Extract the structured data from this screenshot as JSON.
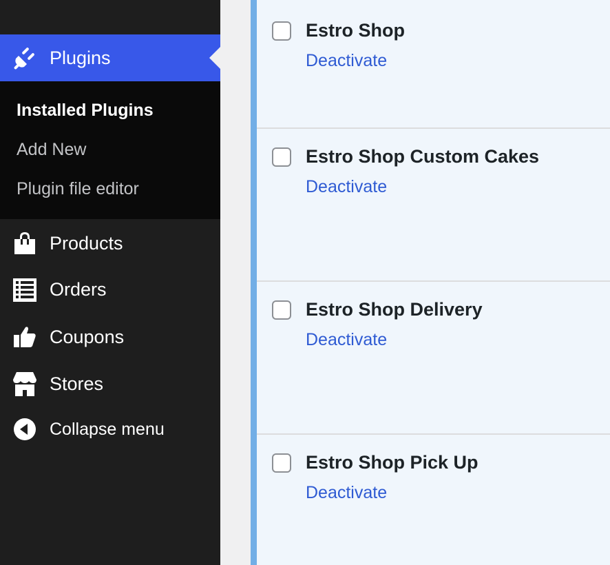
{
  "sidebar": {
    "plugins_label": "Plugins",
    "submenu": {
      "installed": "Installed Plugins",
      "add_new": "Add New",
      "editor": "Plugin file editor"
    },
    "items": [
      {
        "label": "Products",
        "icon": "shopping-bag-icon"
      },
      {
        "label": "Orders",
        "icon": "list-icon"
      },
      {
        "label": "Coupons",
        "icon": "thumbs-up-icon"
      },
      {
        "label": "Stores",
        "icon": "storefront-icon"
      },
      {
        "label": "Collapse menu",
        "icon": "collapse-icon"
      }
    ]
  },
  "plugins": [
    {
      "name": "Estro Shop",
      "action": "Deactivate"
    },
    {
      "name": "Estro Shop Custom Cakes",
      "action": "Deactivate"
    },
    {
      "name": "Estro Shop Delivery",
      "action": "Deactivate"
    },
    {
      "name": "Estro Shop Pick Up",
      "action": "Deactivate"
    }
  ],
  "colors": {
    "sidebar_bg": "#1e1e1e",
    "active_menu": "#3858e9",
    "link": "#2f5bd3",
    "active_row_border": "#72aee6"
  }
}
